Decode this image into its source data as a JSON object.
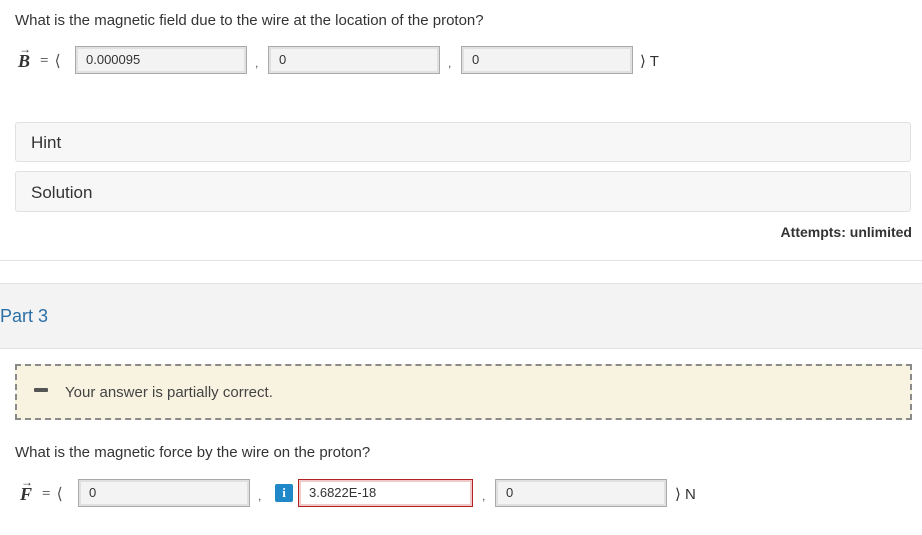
{
  "part2": {
    "question": "What is the magnetic field due to the wire at the location of the proton?",
    "vector_symbol": "B",
    "equals": "=",
    "open_bracket": "⟨",
    "close_bracket": "⟩",
    "inputs": [
      "0.000095",
      "0",
      "0"
    ],
    "unit": "T",
    "hint_label": "Hint",
    "solution_label": "Solution",
    "attempts": "Attempts: unlimited"
  },
  "part3": {
    "title": "Part 3",
    "feedback": "Your answer is partially correct.",
    "question": "What is the magnetic force by the wire on the proton?",
    "vector_symbol": "F",
    "equals": "=",
    "open_bracket": "⟨",
    "close_bracket": "⟩",
    "inputs": [
      "0",
      "3.6822E-18",
      "0"
    ],
    "unit": "N",
    "info_icon_text": "i"
  },
  "icons": {
    "arrow": "vector-arrow-icon",
    "partial": "partially-correct-icon",
    "info": "info-icon"
  },
  "colors": {
    "part_title": "#2a6fa8",
    "feedback_bg": "#f8f3e0",
    "error_border": "#b22222",
    "info_blue": "#1e88c8"
  }
}
